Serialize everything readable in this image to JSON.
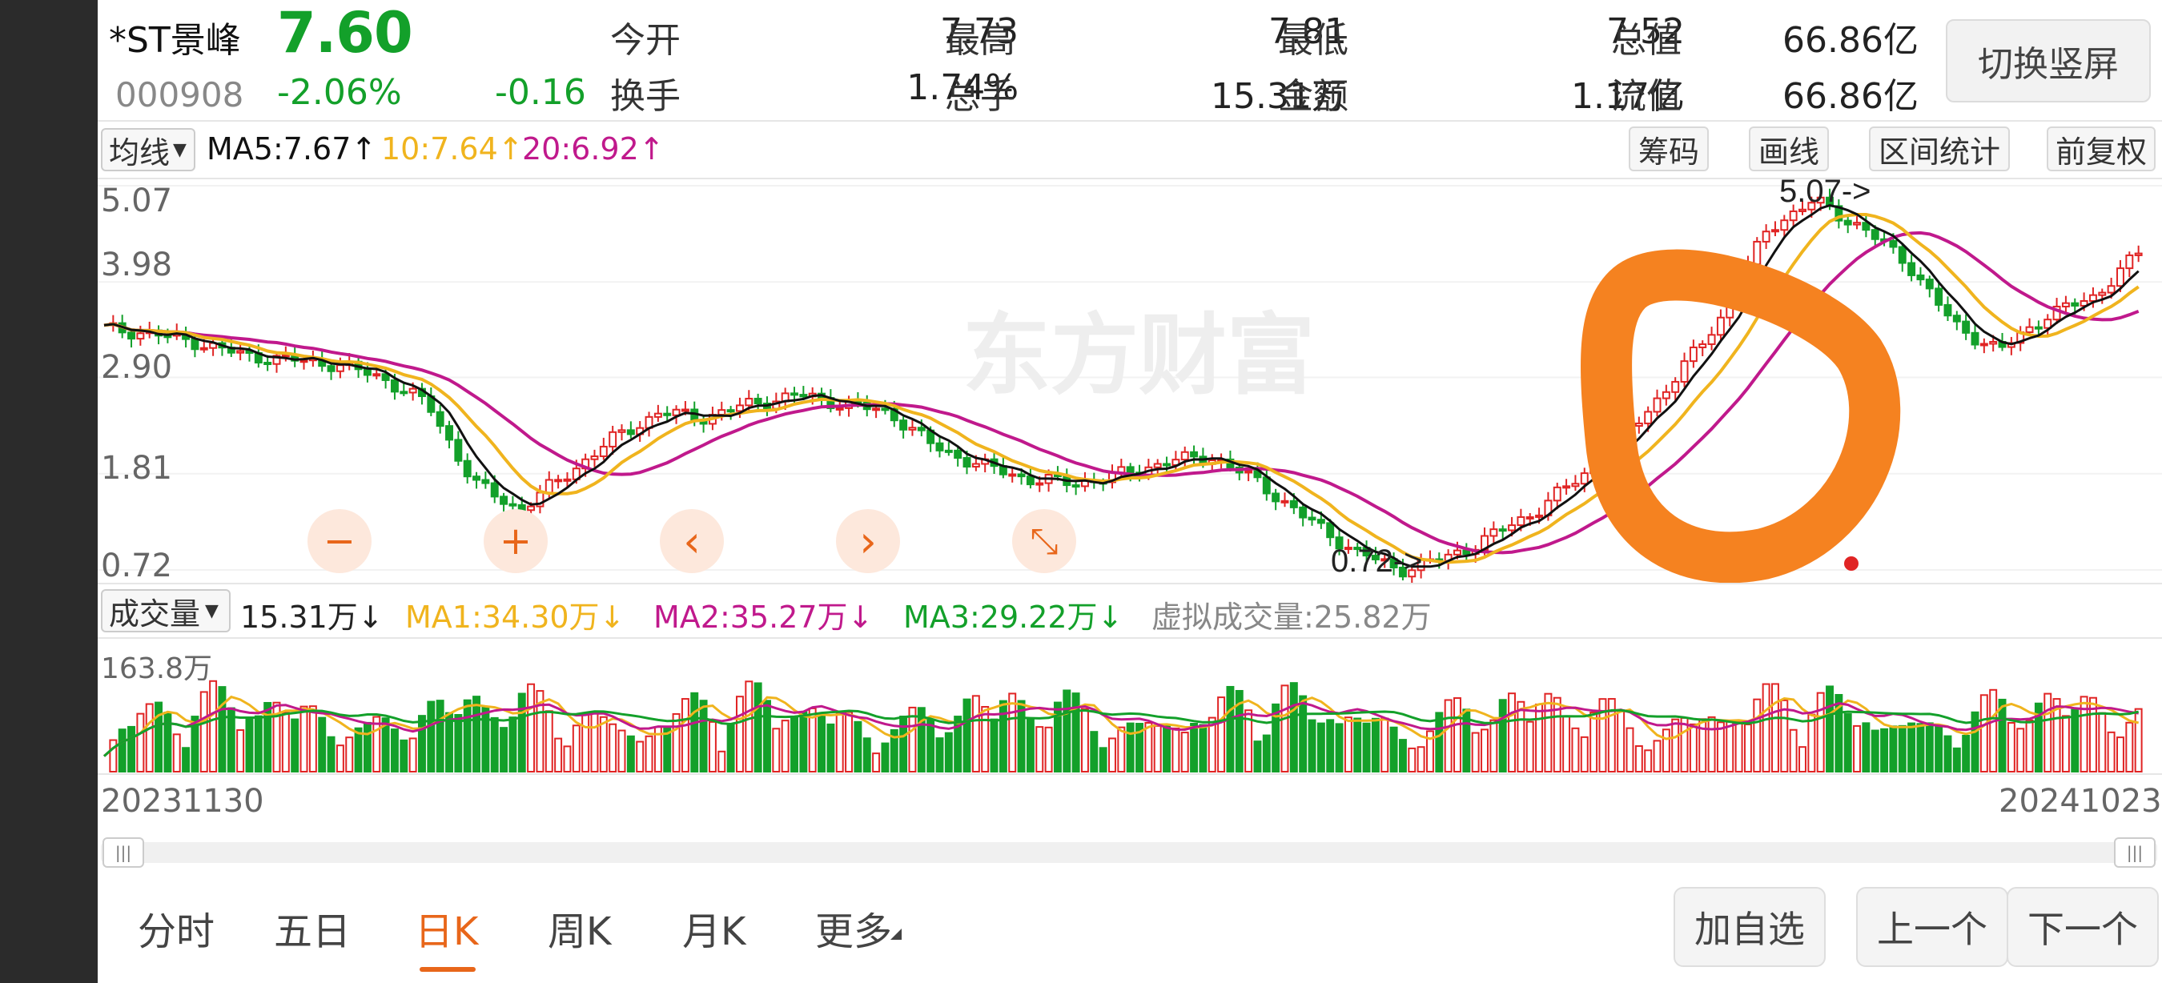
{
  "stock": {
    "name": "*ST景峰",
    "price": "7.60",
    "code": "000908",
    "change_pct": "-2.06%",
    "change": "-0.16"
  },
  "stats": {
    "open_label": "今开",
    "open": "7.73",
    "high_label": "最高",
    "high": "7.81",
    "low_label": "最低",
    "low": "7.52",
    "mktcap_label": "总值",
    "mktcap": "66.86亿",
    "turnover_label": "换手",
    "turnover": "1.74%",
    "volume_label": "总手",
    "volume": "15.31万",
    "amount_label": "金额",
    "amount": "1.17亿",
    "float_label": "流值",
    "float_cap": "66.86亿"
  },
  "switch_button": "切换竖屏",
  "ma_bar": {
    "selector": "均线",
    "ma5": "MA5:7.67↑",
    "ma10": "10:7.64↑",
    "ma20": "20:6.92↑",
    "buttons": [
      "筹码",
      "画线",
      "区间统计",
      "前复权"
    ]
  },
  "volume_bar": {
    "selector": "成交量",
    "current": "15.31万↓",
    "ma1": "MA1:34.30万↓",
    "ma2": "MA2:35.27万↓",
    "ma3": "MA3:29.22万↓",
    "virtual": "虚拟成交量:25.82万",
    "max_label": "163.8万"
  },
  "chart_controls": [
    "−",
    "+",
    "‹",
    "›",
    "⤡"
  ],
  "watermark": "东方财富",
  "date_start": "20231130",
  "date_end": "20241023",
  "scroll_handle": "|||",
  "bottom_tabs": [
    "分时",
    "五日",
    "日K",
    "周K",
    "月K",
    "更多"
  ],
  "active_tab": "日K",
  "bottom_buttons": [
    "加自选",
    "上一个",
    "下一个"
  ],
  "colors": {
    "up": "#e02424",
    "down": "#13a02a",
    "ma5": "#111111",
    "ma10": "#f0b41e",
    "ma20": "#c0198c",
    "accent": "#e8661a",
    "annotation": "#f58220"
  },
  "chart_data": {
    "type": "candlestick",
    "y_ticks": [
      "5.07",
      "3.98",
      "2.90",
      "1.81",
      "0.72"
    ],
    "ylim": [
      0.72,
      5.07
    ],
    "x_labels": [
      "20231130",
      "20241023"
    ],
    "max_label": "5.07->",
    "min_label": "0.72->",
    "price_series_approx": [
      3.45,
      3.4,
      3.3,
      3.15,
      3.1,
      3.05,
      2.9,
      2.6,
      1.7,
      1.4,
      1.8,
      2.2,
      2.5,
      2.45,
      2.6,
      2.7,
      2.6,
      2.5,
      2.1,
      1.9,
      1.75,
      1.7,
      1.8,
      1.95,
      2.0,
      1.7,
      1.3,
      0.95,
      0.72,
      0.85,
      1.1,
      1.4,
      1.8,
      2.3,
      2.9,
      3.6,
      4.6,
      4.9,
      4.6,
      4.2,
      3.5,
      3.2,
      3.6,
      3.8,
      4.3
    ],
    "volume_max": "163.8万"
  }
}
